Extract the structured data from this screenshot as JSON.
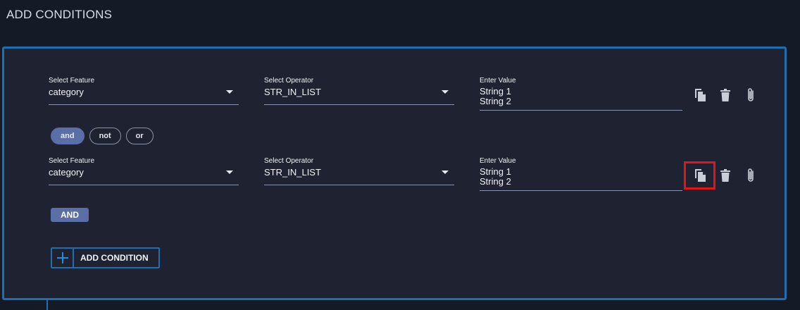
{
  "header": {
    "title": "ADD CONDITIONS"
  },
  "conditions": [
    {
      "feature_label": "Select Feature",
      "feature_value": "category",
      "operator_label": "Select Operator",
      "operator_value": "STR_IN_LIST",
      "value_label": "Enter Value",
      "value_lines": [
        "String 1",
        "String 2"
      ]
    },
    {
      "feature_label": "Select Feature",
      "feature_value": "category",
      "operator_label": "Select Operator",
      "operator_value": "STR_IN_LIST",
      "value_label": "Enter Value",
      "value_lines": [
        "String 1",
        "String 2"
      ]
    }
  ],
  "logic_ops": {
    "and": "and",
    "not": "not",
    "or": "or",
    "selected": "and"
  },
  "group_operator": "AND",
  "add_condition": {
    "label": "ADD CONDITION"
  },
  "icons": {
    "duplicate": "copy-icon",
    "delete": "trash-icon",
    "attach": "paperclip-icon",
    "add": "plus-icon"
  },
  "colors": {
    "background": "#141a26",
    "panel": "#1f2331",
    "accent_blue": "#1f6fb0",
    "chip_active": "#5a6fa6",
    "highlight_red": "#e11616"
  }
}
